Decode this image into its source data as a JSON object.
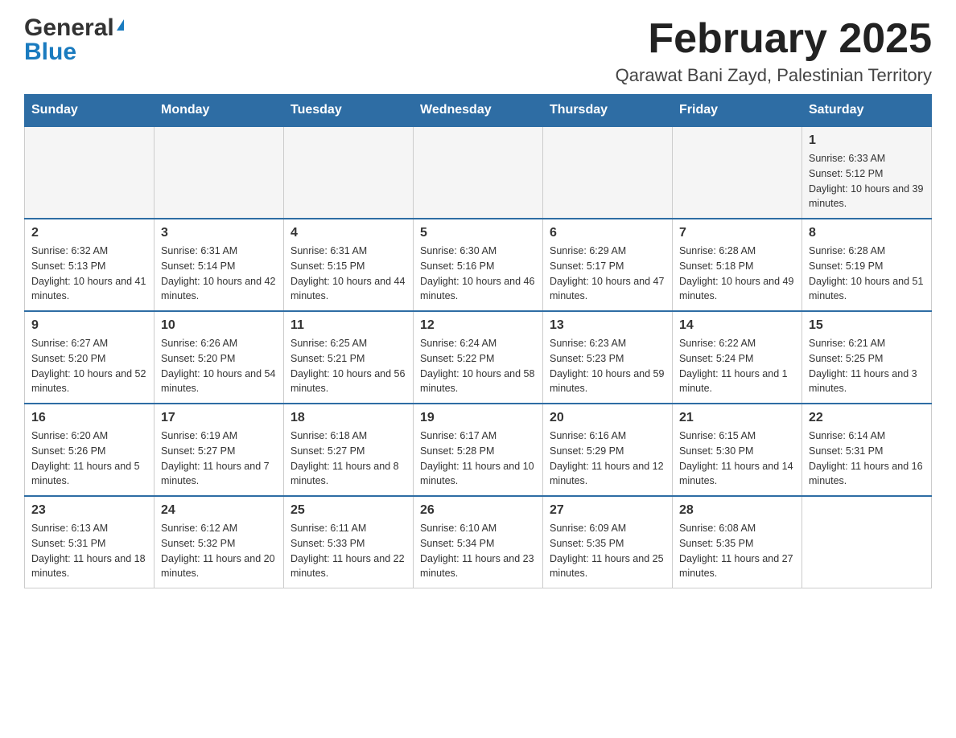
{
  "header": {
    "logo_general": "General",
    "logo_blue": "Blue",
    "month_title": "February 2025",
    "location": "Qarawat Bani Zayd, Palestinian Territory"
  },
  "weekdays": [
    "Sunday",
    "Monday",
    "Tuesday",
    "Wednesday",
    "Thursday",
    "Friday",
    "Saturday"
  ],
  "weeks": [
    [
      {
        "day": "",
        "info": ""
      },
      {
        "day": "",
        "info": ""
      },
      {
        "day": "",
        "info": ""
      },
      {
        "day": "",
        "info": ""
      },
      {
        "day": "",
        "info": ""
      },
      {
        "day": "",
        "info": ""
      },
      {
        "day": "1",
        "info": "Sunrise: 6:33 AM\nSunset: 5:12 PM\nDaylight: 10 hours and 39 minutes."
      }
    ],
    [
      {
        "day": "2",
        "info": "Sunrise: 6:32 AM\nSunset: 5:13 PM\nDaylight: 10 hours and 41 minutes."
      },
      {
        "day": "3",
        "info": "Sunrise: 6:31 AM\nSunset: 5:14 PM\nDaylight: 10 hours and 42 minutes."
      },
      {
        "day": "4",
        "info": "Sunrise: 6:31 AM\nSunset: 5:15 PM\nDaylight: 10 hours and 44 minutes."
      },
      {
        "day": "5",
        "info": "Sunrise: 6:30 AM\nSunset: 5:16 PM\nDaylight: 10 hours and 46 minutes."
      },
      {
        "day": "6",
        "info": "Sunrise: 6:29 AM\nSunset: 5:17 PM\nDaylight: 10 hours and 47 minutes."
      },
      {
        "day": "7",
        "info": "Sunrise: 6:28 AM\nSunset: 5:18 PM\nDaylight: 10 hours and 49 minutes."
      },
      {
        "day": "8",
        "info": "Sunrise: 6:28 AM\nSunset: 5:19 PM\nDaylight: 10 hours and 51 minutes."
      }
    ],
    [
      {
        "day": "9",
        "info": "Sunrise: 6:27 AM\nSunset: 5:20 PM\nDaylight: 10 hours and 52 minutes."
      },
      {
        "day": "10",
        "info": "Sunrise: 6:26 AM\nSunset: 5:20 PM\nDaylight: 10 hours and 54 minutes."
      },
      {
        "day": "11",
        "info": "Sunrise: 6:25 AM\nSunset: 5:21 PM\nDaylight: 10 hours and 56 minutes."
      },
      {
        "day": "12",
        "info": "Sunrise: 6:24 AM\nSunset: 5:22 PM\nDaylight: 10 hours and 58 minutes."
      },
      {
        "day": "13",
        "info": "Sunrise: 6:23 AM\nSunset: 5:23 PM\nDaylight: 10 hours and 59 minutes."
      },
      {
        "day": "14",
        "info": "Sunrise: 6:22 AM\nSunset: 5:24 PM\nDaylight: 11 hours and 1 minute."
      },
      {
        "day": "15",
        "info": "Sunrise: 6:21 AM\nSunset: 5:25 PM\nDaylight: 11 hours and 3 minutes."
      }
    ],
    [
      {
        "day": "16",
        "info": "Sunrise: 6:20 AM\nSunset: 5:26 PM\nDaylight: 11 hours and 5 minutes."
      },
      {
        "day": "17",
        "info": "Sunrise: 6:19 AM\nSunset: 5:27 PM\nDaylight: 11 hours and 7 minutes."
      },
      {
        "day": "18",
        "info": "Sunrise: 6:18 AM\nSunset: 5:27 PM\nDaylight: 11 hours and 8 minutes."
      },
      {
        "day": "19",
        "info": "Sunrise: 6:17 AM\nSunset: 5:28 PM\nDaylight: 11 hours and 10 minutes."
      },
      {
        "day": "20",
        "info": "Sunrise: 6:16 AM\nSunset: 5:29 PM\nDaylight: 11 hours and 12 minutes."
      },
      {
        "day": "21",
        "info": "Sunrise: 6:15 AM\nSunset: 5:30 PM\nDaylight: 11 hours and 14 minutes."
      },
      {
        "day": "22",
        "info": "Sunrise: 6:14 AM\nSunset: 5:31 PM\nDaylight: 11 hours and 16 minutes."
      }
    ],
    [
      {
        "day": "23",
        "info": "Sunrise: 6:13 AM\nSunset: 5:31 PM\nDaylight: 11 hours and 18 minutes."
      },
      {
        "day": "24",
        "info": "Sunrise: 6:12 AM\nSunset: 5:32 PM\nDaylight: 11 hours and 20 minutes."
      },
      {
        "day": "25",
        "info": "Sunrise: 6:11 AM\nSunset: 5:33 PM\nDaylight: 11 hours and 22 minutes."
      },
      {
        "day": "26",
        "info": "Sunrise: 6:10 AM\nSunset: 5:34 PM\nDaylight: 11 hours and 23 minutes."
      },
      {
        "day": "27",
        "info": "Sunrise: 6:09 AM\nSunset: 5:35 PM\nDaylight: 11 hours and 25 minutes."
      },
      {
        "day": "28",
        "info": "Sunrise: 6:08 AM\nSunset: 5:35 PM\nDaylight: 11 hours and 27 minutes."
      },
      {
        "day": "",
        "info": ""
      }
    ]
  ]
}
